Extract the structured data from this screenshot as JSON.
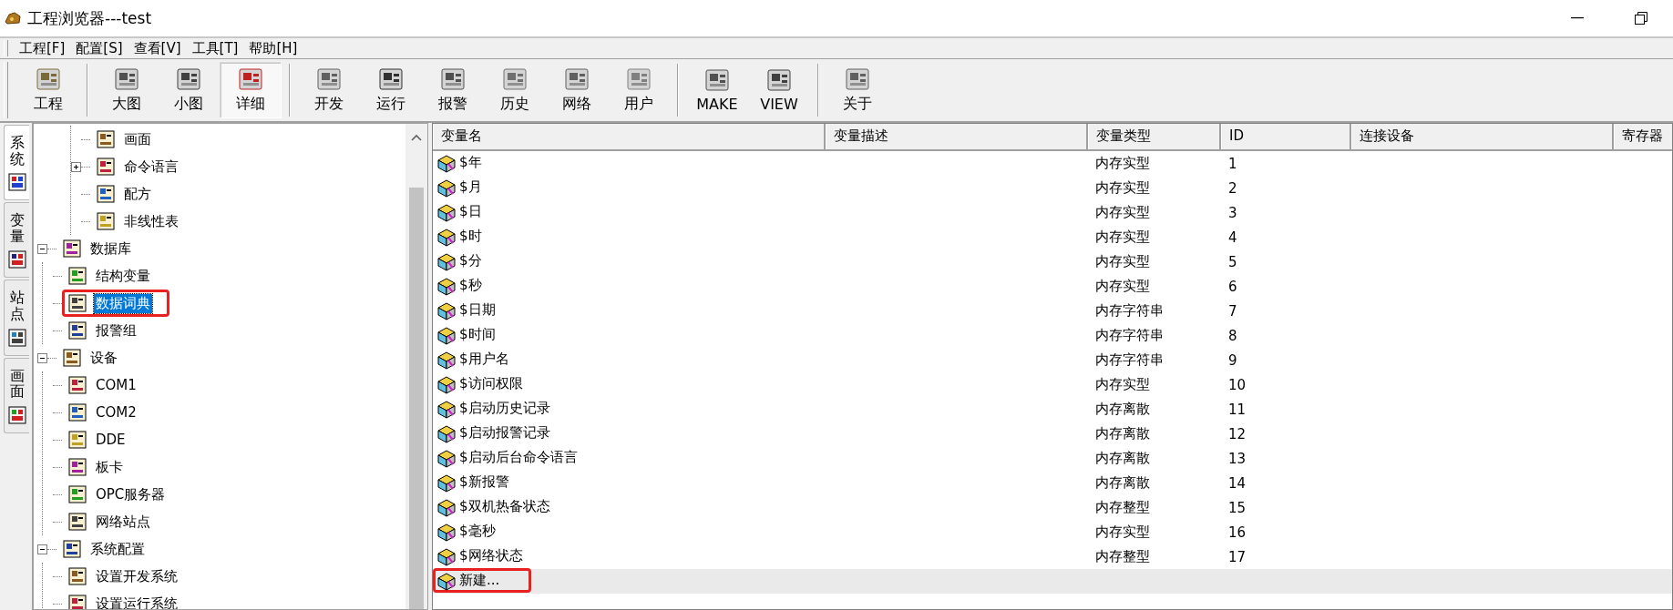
{
  "window": {
    "title": "工程浏览器---test"
  },
  "menu": [
    {
      "label": "工程[F]"
    },
    {
      "label": "配置[S]"
    },
    {
      "label": "查看[V]"
    },
    {
      "label": "工具[T]"
    },
    {
      "label": "帮助[H]"
    }
  ],
  "toolbar": [
    [
      {
        "label": "工程",
        "selected": false
      }
    ],
    [
      {
        "label": "大图",
        "selected": false
      },
      {
        "label": "小图",
        "selected": false
      },
      {
        "label": "详细",
        "selected": true
      }
    ],
    [
      {
        "label": "开发",
        "selected": false
      },
      {
        "label": "运行",
        "selected": false
      },
      {
        "label": "报警",
        "selected": false
      },
      {
        "label": "历史",
        "selected": false
      },
      {
        "label": "网络",
        "selected": false
      },
      {
        "label": "用户",
        "selected": false
      }
    ],
    [
      {
        "label": "MAKE",
        "selected": false
      },
      {
        "label": "VIEW",
        "selected": false
      }
    ],
    [
      {
        "label": "关于",
        "selected": false
      }
    ]
  ],
  "side_tabs": [
    {
      "label": "系统",
      "selected": true
    },
    {
      "label": "变量",
      "selected": false
    },
    {
      "label": "站点",
      "selected": false
    },
    {
      "label": "画面",
      "selected": false
    }
  ],
  "tree": [
    {
      "children": [
        {
          "label": "画面",
          "selected": false,
          "marked": false
        },
        {
          "label": "命令语言",
          "expanded": false,
          "selected": false,
          "marked": false
        },
        {
          "label": "配方",
          "selected": false,
          "marked": false
        },
        {
          "label": "非线性表",
          "selected": false,
          "marked": false
        }
      ]
    },
    {
      "label": "数据库",
      "expanded": true,
      "selected": false,
      "marked": false,
      "children": [
        {
          "label": "结构变量",
          "selected": false,
          "marked": false
        },
        {
          "label": "数据词典",
          "selected": true,
          "marked": true
        },
        {
          "label": "报警组",
          "selected": false,
          "marked": false
        }
      ]
    },
    {
      "label": "设备",
      "expanded": true,
      "selected": false,
      "marked": false,
      "children": [
        {
          "label": "COM1",
          "selected": false,
          "marked": false
        },
        {
          "label": "COM2",
          "selected": false,
          "marked": false
        },
        {
          "label": "DDE",
          "selected": false,
          "marked": false
        },
        {
          "label": "板卡",
          "selected": false,
          "marked": false
        },
        {
          "label": "OPC服务器",
          "selected": false,
          "marked": false
        },
        {
          "label": "网络站点",
          "selected": false,
          "marked": false
        }
      ]
    },
    {
      "label": "系统配置",
      "expanded": true,
      "selected": false,
      "marked": false,
      "children": [
        {
          "label": "设置开发系统",
          "selected": false,
          "marked": false
        },
        {
          "label": "设置运行系统",
          "selected": false,
          "marked": false
        }
      ]
    }
  ],
  "table": {
    "columns": [
      "变量名",
      "变量描述",
      "变量类型",
      "ID",
      "连接设备",
      "寄存器"
    ],
    "rows": [
      {
        "kind": "variable",
        "name": "$年",
        "type": "内存实型",
        "id": "1",
        "selected": false,
        "marked": false
      },
      {
        "kind": "variable",
        "name": "$月",
        "type": "内存实型",
        "id": "2",
        "selected": false,
        "marked": false
      },
      {
        "kind": "variable",
        "name": "$日",
        "type": "内存实型",
        "id": "3",
        "selected": false,
        "marked": false
      },
      {
        "kind": "variable",
        "name": "$时",
        "type": "内存实型",
        "id": "4",
        "selected": false,
        "marked": false
      },
      {
        "kind": "variable",
        "name": "$分",
        "type": "内存实型",
        "id": "5",
        "selected": false,
        "marked": false
      },
      {
        "kind": "variable",
        "name": "$秒",
        "type": "内存实型",
        "id": "6",
        "selected": false,
        "marked": false
      },
      {
        "kind": "variable",
        "name": "$日期",
        "type": "内存字符串",
        "id": "7",
        "selected": false,
        "marked": false
      },
      {
        "kind": "variable",
        "name": "$时间",
        "type": "内存字符串",
        "id": "8",
        "selected": false,
        "marked": false
      },
      {
        "kind": "variable",
        "name": "$用户名",
        "type": "内存字符串",
        "id": "9",
        "selected": false,
        "marked": false
      },
      {
        "kind": "variable",
        "name": "$访问权限",
        "type": "内存实型",
        "id": "10",
        "selected": false,
        "marked": false
      },
      {
        "kind": "variable",
        "name": "$启动历史记录",
        "type": "内存离散",
        "id": "11",
        "selected": false,
        "marked": false
      },
      {
        "kind": "variable",
        "name": "$启动报警记录",
        "type": "内存离散",
        "id": "12",
        "selected": false,
        "marked": false
      },
      {
        "kind": "variable",
        "name": "$启动后台命令语言",
        "type": "内存离散",
        "id": "13",
        "selected": false,
        "marked": false
      },
      {
        "kind": "variable",
        "name": "$新报警",
        "type": "内存离散",
        "id": "14",
        "selected": false,
        "marked": false
      },
      {
        "kind": "variable",
        "name": "$双机热备状态",
        "type": "内存整型",
        "id": "15",
        "selected": false,
        "marked": false
      },
      {
        "kind": "variable",
        "name": "$毫秒",
        "type": "内存实型",
        "id": "16",
        "selected": false,
        "marked": false
      },
      {
        "kind": "variable",
        "name": "$网络状态",
        "type": "内存整型",
        "id": "17",
        "selected": false,
        "marked": false
      },
      {
        "kind": "new",
        "name": "新建...",
        "selected": true,
        "marked": true
      }
    ]
  }
}
